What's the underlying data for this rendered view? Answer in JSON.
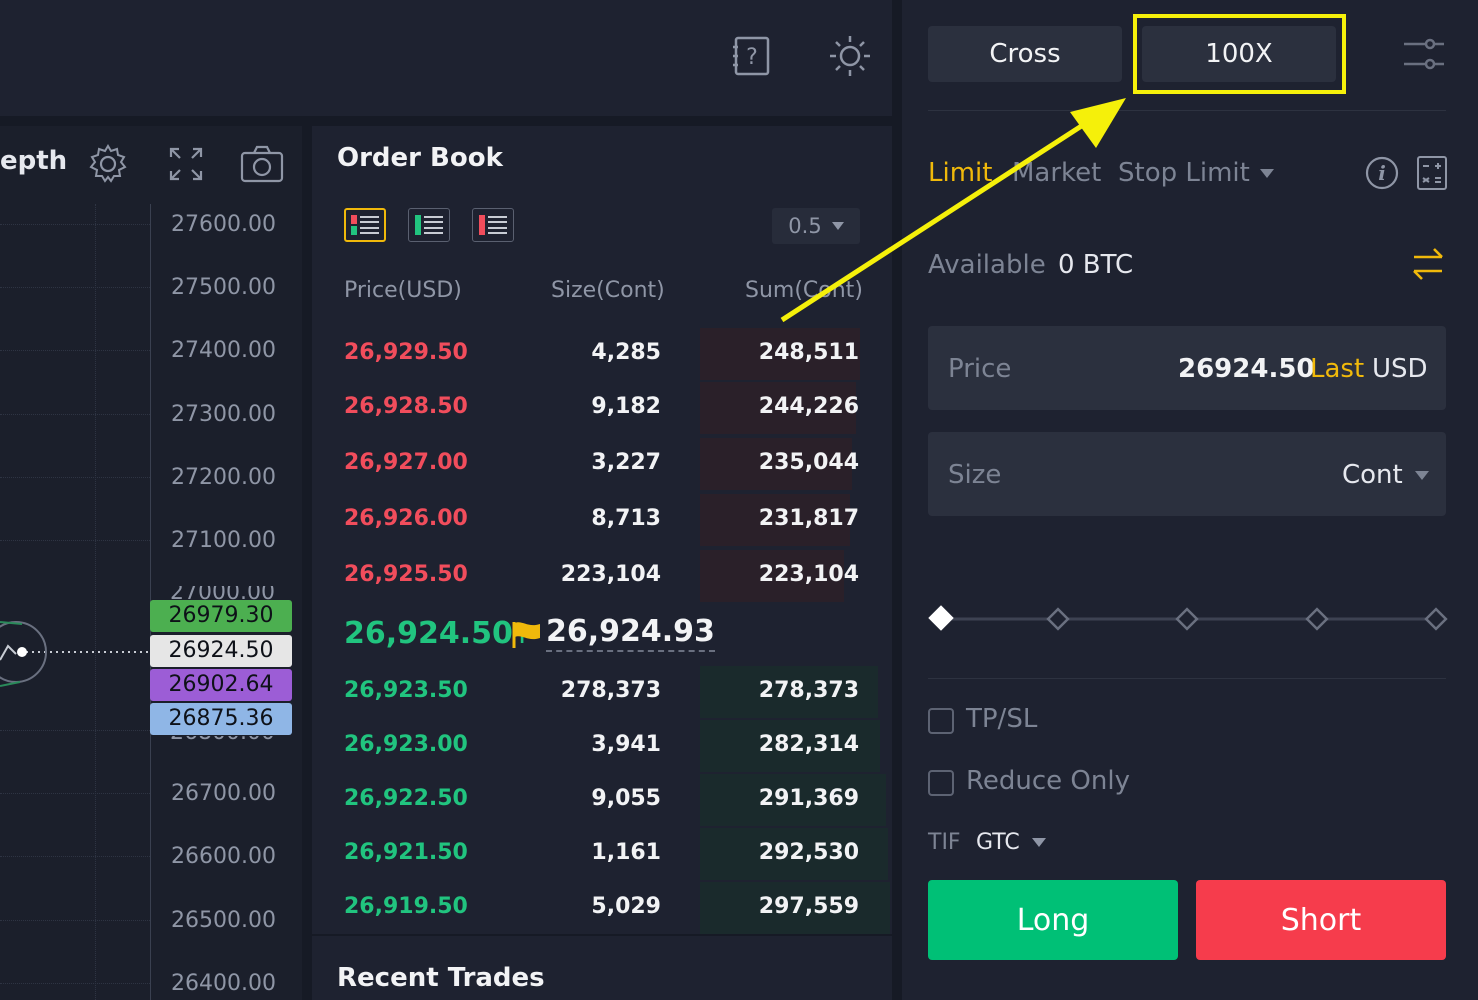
{
  "chart": {
    "tab_partial": "epth",
    "axis_labels": [
      "27600.00",
      "27500.00",
      "27400.00",
      "27300.00",
      "27200.00",
      "27100.00",
      "26700.00",
      "26600.00",
      "26500.00",
      "26400.00"
    ],
    "price_tags": [
      {
        "value": "26979.30",
        "color": "#4caf50"
      },
      {
        "value": "26924.50",
        "color": "#e6e6e6"
      },
      {
        "value": "26902.64",
        "color": "#9c5dd6"
      },
      {
        "value": "26875.36",
        "color": "#8fb6e6"
      }
    ]
  },
  "order_book": {
    "title": "Order Book",
    "step": "0.5",
    "columns": {
      "price": "Price(USD)",
      "size": "Size(Cont)",
      "sum": "Sum(Cont)"
    },
    "asks": [
      {
        "price": "26,929.50",
        "size": "4,285",
        "sum": "248,511"
      },
      {
        "price": "26,928.50",
        "size": "9,182",
        "sum": "244,226"
      },
      {
        "price": "26,927.00",
        "size": "3,227",
        "sum": "235,044"
      },
      {
        "price": "26,926.00",
        "size": "8,713",
        "sum": "231,817"
      },
      {
        "price": "26,925.50",
        "size": "223,104",
        "sum": "223,104"
      }
    ],
    "last_price": "26,924.50",
    "last_arrow": "↑",
    "mark_price": "26,924.93",
    "bids": [
      {
        "price": "26,923.50",
        "size": "278,373",
        "sum": "278,373"
      },
      {
        "price": "26,923.00",
        "size": "3,941",
        "sum": "282,314"
      },
      {
        "price": "26,922.50",
        "size": "9,055",
        "sum": "291,369"
      },
      {
        "price": "26,921.50",
        "size": "1,161",
        "sum": "292,530"
      },
      {
        "price": "26,919.50",
        "size": "5,029",
        "sum": "297,559"
      }
    ]
  },
  "recent_trades": {
    "title": "Recent Trades"
  },
  "trade_panel": {
    "margin_mode": "Cross",
    "leverage": "100X",
    "order_tabs": {
      "limit": "Limit",
      "market": "Market",
      "stop_limit": "Stop Limit"
    },
    "available_label": "Available",
    "available_value": "0 BTC",
    "price": {
      "label": "Price",
      "value": "26924.50",
      "tag": "Last",
      "unit": "USD"
    },
    "size": {
      "label": "Size",
      "unit": "Cont"
    },
    "tpsl_label": "TP/SL",
    "reduce_only_label": "Reduce Only",
    "tif_label": "TIF",
    "tif_value": "GTC",
    "long_label": "Long",
    "short_label": "Short"
  },
  "colors": {
    "ask": "#f14d5c",
    "bid": "#21c47f",
    "accent": "#f0b90b",
    "long": "#00c076",
    "short": "#f63c4c",
    "annotation": "#f5f00a"
  }
}
